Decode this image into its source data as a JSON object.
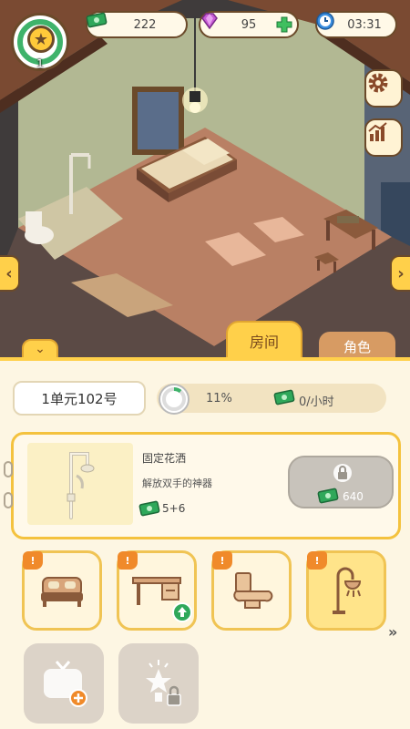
{
  "hud": {
    "level": "1",
    "cash": "222",
    "gems": "95",
    "time": "03:31"
  },
  "tabs": {
    "room": "房间",
    "character": "角色"
  },
  "panel": {
    "room_name": "1单元102号",
    "progress": "11%",
    "progress_value": 0.11,
    "income": "0/小时"
  },
  "item": {
    "name": "固定花洒",
    "description": "解放双手的神器",
    "reward": "5+6",
    "price": "640"
  },
  "categories": [
    {
      "name": "bed",
      "badge": "!"
    },
    {
      "name": "desk",
      "badge": "!"
    },
    {
      "name": "toilet",
      "badge": "!"
    },
    {
      "name": "shower",
      "badge": "!"
    }
  ],
  "icons": {
    "cash": "cash-icon",
    "gem": "gem-icon",
    "add": "plus-icon",
    "clock": "clock-icon",
    "settings": "gear-icon",
    "stats": "chart-icon",
    "lock": "lock-icon"
  },
  "colors": {
    "accent": "#ffd04a",
    "cash": "#2fa85a",
    "gem": "#c85bd6",
    "clock": "#3a8ee0"
  }
}
